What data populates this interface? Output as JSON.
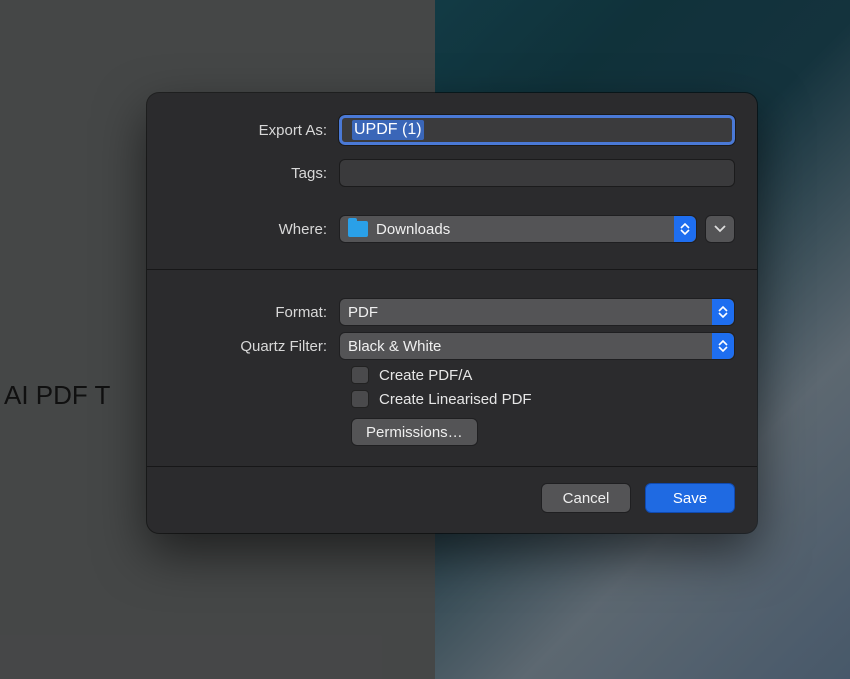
{
  "background": {
    "left_text": "st AI PDF T"
  },
  "dialog": {
    "export_as": {
      "label": "Export As:",
      "value": "UPDF (1)"
    },
    "tags": {
      "label": "Tags:"
    },
    "where": {
      "label": "Where:",
      "value": "Downloads"
    },
    "format": {
      "label": "Format:",
      "value": "PDF"
    },
    "quartz_filter": {
      "label": "Quartz Filter:",
      "value": "Black & White"
    },
    "checks": [
      "Create PDF/A",
      "Create Linearised PDF"
    ],
    "permissions_label": "Permissions…",
    "buttons": {
      "cancel": "Cancel",
      "save": "Save"
    }
  }
}
